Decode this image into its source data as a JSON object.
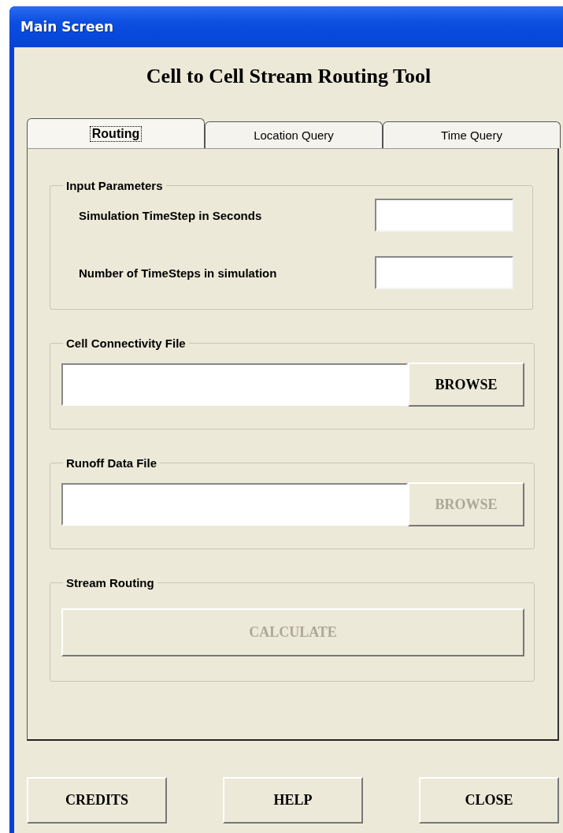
{
  "window": {
    "title": "Main Screen"
  },
  "heading": "Cell to Cell Stream Routing Tool",
  "tabs": [
    {
      "label": "Routing",
      "selected": true
    },
    {
      "label": "Location Query",
      "selected": false
    },
    {
      "label": "Time Query",
      "selected": false
    }
  ],
  "groups": [
    {
      "kind": "params",
      "title": "Input Parameters",
      "fields": [
        {
          "label": "Simulation TimeStep in Seconds"
        },
        {
          "label": "Number of TimeSteps in simulation"
        }
      ]
    },
    {
      "kind": "file",
      "title": "Cell Connectivity File",
      "button": {
        "label": "BROWSE",
        "disabled": false
      }
    },
    {
      "kind": "file",
      "title": "Runoff Data File",
      "button": {
        "label": "BROWSE",
        "disabled": true
      }
    },
    {
      "kind": "action",
      "title": "Stream Routing",
      "button": {
        "label": "CALCULATE",
        "disabled": true
      }
    }
  ],
  "buttons": [
    {
      "label": "CREDITS"
    },
    {
      "label": "HELP"
    },
    {
      "label": "CLOSE"
    }
  ]
}
